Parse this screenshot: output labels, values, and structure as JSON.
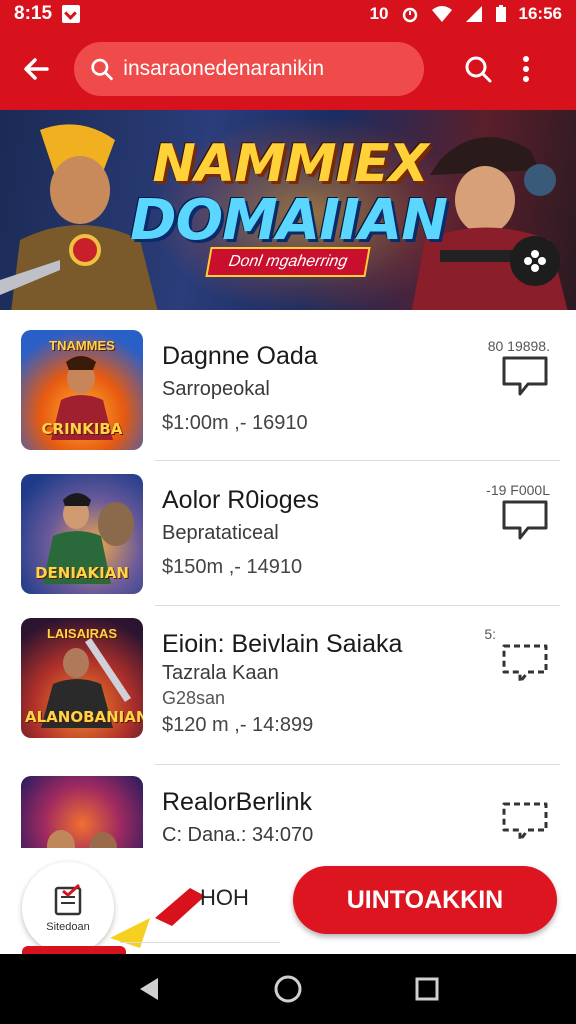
{
  "status_bar": {
    "time": "8:15",
    "right_icons_text": "10",
    "clock_right": "16:56"
  },
  "top_bar": {
    "search_value": "insaraonedenaranikin",
    "icons": [
      "back-arrow-icon",
      "search-icon",
      "more-vert-icon"
    ]
  },
  "banner": {
    "title_line1": "NAMMIEX",
    "title_line2": "DOMAIIAN",
    "tagline": "Donl mgaherring",
    "fab_icon": "sparkle-icon"
  },
  "items": [
    {
      "thumb_top": "TNAMMES",
      "thumb_label": "CRINKIBA",
      "title": "Dagnne Oada",
      "subtitle": "Sarropeokal",
      "price": "$1:00m ,- 16910",
      "meta": "80 19898.",
      "thumb_colors": [
        "#2a6fd8",
        "#f0a020"
      ]
    },
    {
      "thumb_top": "",
      "thumb_label": "DENIAKIAN",
      "title": "Aolor R0ioges",
      "subtitle": "Beprataticeal",
      "price": "$150m ,- 14910",
      "meta": "-19 F000L",
      "thumb_colors": [
        "#1d3b8a",
        "#f3a94a"
      ]
    },
    {
      "thumb_top": "LAISAIRAS",
      "thumb_label": "ALANOBANIAN",
      "title": "Eioin: Beivlain Saiaka",
      "subtitle": "Tazrala Kaan",
      "subtitle2": "G28san",
      "price": "$120 m ,- 14:899",
      "meta": "5:",
      "thumb_colors": [
        "#3b1a3a",
        "#e86a20"
      ]
    },
    {
      "thumb_top": "",
      "thumb_label": "",
      "title": "RealorBerlink",
      "subtitle": "C: Dana.: 34:070",
      "price": "",
      "meta": "",
      "thumb_colors": [
        "#2b1c60",
        "#f05030"
      ]
    }
  ],
  "bottom": {
    "doc_caption": "Sitedoan",
    "secondary_label": "HOH",
    "cta_label": "UINTOAKKIN",
    "doc_icon": "clipboard-icon"
  },
  "nav": {
    "icons": [
      "back-triangle-icon",
      "home-circle-icon",
      "recents-square-icon"
    ]
  },
  "colors": {
    "brand_red": "#d8121d",
    "cta_red": "#dd1520"
  }
}
